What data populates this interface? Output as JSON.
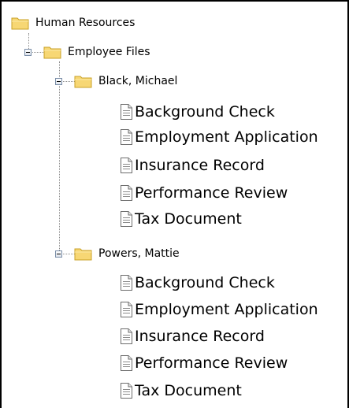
{
  "root": {
    "label": "Human Resources",
    "icon": "folder-icon",
    "children": [
      {
        "label": "Employee Files",
        "icon": "folder-icon",
        "expanded": true,
        "children": [
          {
            "label": "Black, Michael",
            "icon": "folder-icon",
            "expanded": true,
            "documents": [
              "Background Check",
              "Employment Application",
              "Insurance Record",
              "Performance Review",
              "Tax Document"
            ]
          },
          {
            "label": "Powers, Mattie",
            "icon": "folder-icon",
            "expanded": true,
            "documents": [
              "Background Check",
              "Employment Application",
              "Insurance Record",
              "Performance Review",
              "Tax Document"
            ]
          }
        ]
      }
    ]
  },
  "document_icon": "document-icon",
  "toggle_icon": "collapse-minus-icon",
  "colors": {
    "folder_fill": "#f7d774",
    "folder_border": "#c9a227",
    "connector": "#8a8a8a",
    "toggle_border": "#7a8ea8"
  }
}
